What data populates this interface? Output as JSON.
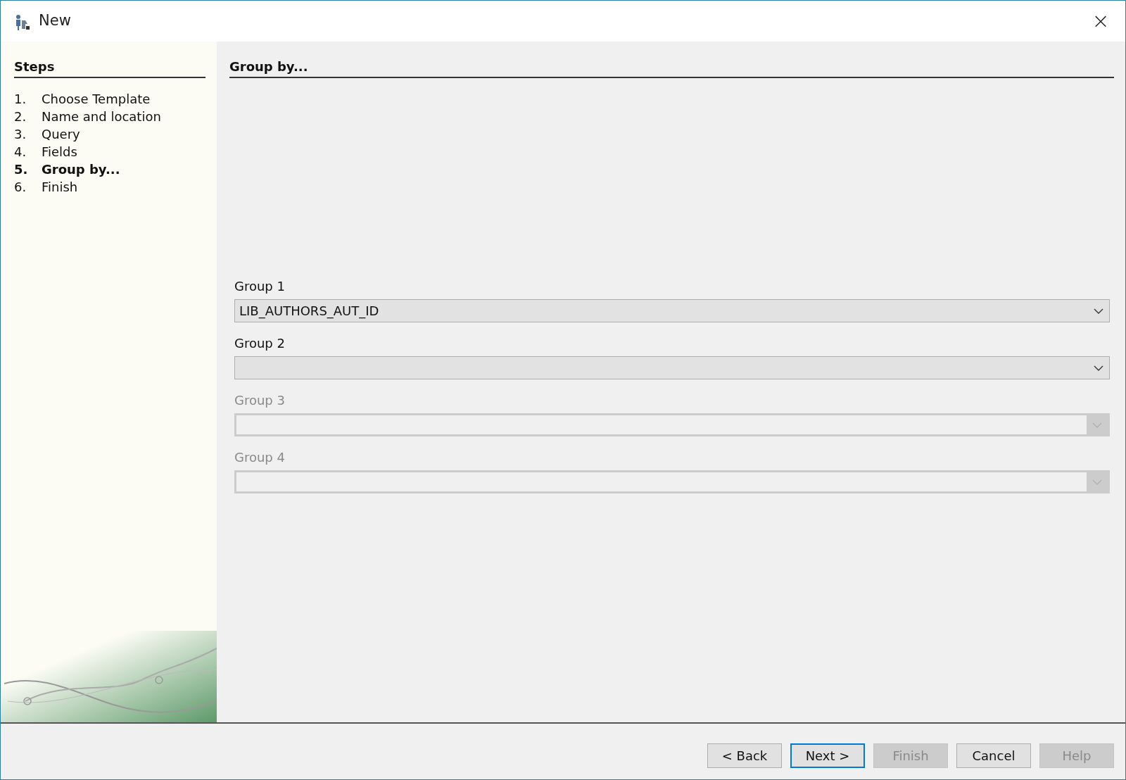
{
  "window": {
    "title": "New",
    "close": "×"
  },
  "steps": {
    "heading": "Steps",
    "items": [
      {
        "number": "1.",
        "label": "Choose Template",
        "selected": false
      },
      {
        "number": "2.",
        "label": "Name and location",
        "selected": false
      },
      {
        "number": "3.",
        "label": "Query",
        "selected": false
      },
      {
        "number": "4.",
        "label": "Fields",
        "selected": false
      },
      {
        "number": "5.",
        "label": "Group by...",
        "selected": true
      },
      {
        "number": "6.",
        "label": "Finish",
        "selected": false
      }
    ]
  },
  "page": {
    "heading": "Group by...",
    "fields": [
      {
        "label": "Group 1",
        "value": "LIB_AUTHORS_AUT_ID",
        "disabled": false
      },
      {
        "label": "Group 2",
        "disabled": false
      },
      {
        "label": "Group 3",
        "disabled": true
      },
      {
        "label": "Group 4",
        "disabled": true
      }
    ]
  },
  "buttons": [
    {
      "label": "< Back",
      "disabled": false,
      "default": false
    },
    {
      "label": "Next >",
      "disabled": false,
      "default": true
    },
    {
      "label": "Finish",
      "disabled": true,
      "default": false
    },
    {
      "label": "Cancel",
      "disabled": false,
      "default": false
    },
    {
      "label": "Help",
      "disabled": true,
      "default": false
    }
  ]
}
